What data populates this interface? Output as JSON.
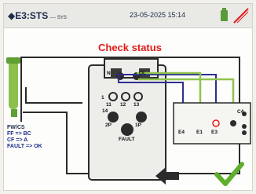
{
  "statusbar": {
    "mode": "◆E3:STS",
    "system": "---- SYS",
    "datetime": "23-05-2025  15:14"
  },
  "diagram": {
    "caption": "Check status",
    "terminals": {
      "n": "N",
      "ol": "OL",
      "t_one": "1",
      "t_11": "11",
      "t_12": "12",
      "t_13": "13",
      "t_14": "14",
      "p_left": "2P",
      "p_right": "1P",
      "fault": "FAULT",
      "e4": "E4",
      "e1": "E1",
      "e3": "E3",
      "c4": "C4"
    },
    "legend": {
      "title": "FW/CS",
      "line1": "FF => BC",
      "line2": "CF => A",
      "line3": "FAULT => OK"
    }
  },
  "actions": {
    "back_icon": "arrow-left-icon",
    "confirm_icon": "checkmark-icon"
  },
  "colors": {
    "wire_black": "#2b2b2b",
    "wire_blue": "#2d2f8f",
    "wire_green": "#8fc44e",
    "highlight_red": "#e01b1b",
    "socket_green": "#6fb33a"
  }
}
